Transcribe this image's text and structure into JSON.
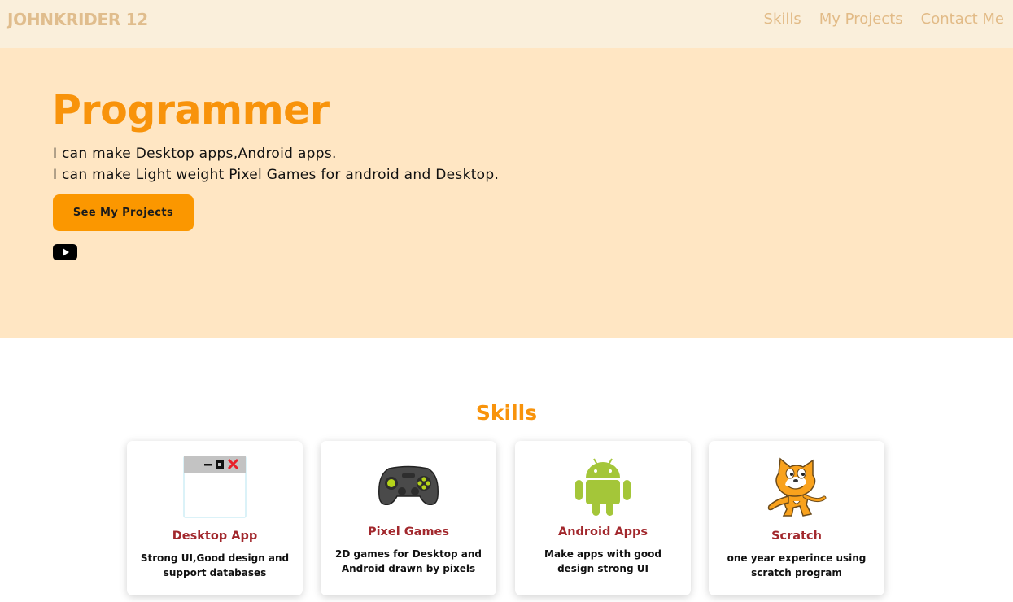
{
  "nav": {
    "brand": "JOHNKRIDER 12",
    "links": [
      "Skills",
      "My Projects",
      "Contact Me"
    ]
  },
  "hero": {
    "title": "Programmer",
    "line1": "I can make Desktop apps,Android apps.",
    "line2": "I can make Light weight Pixel Games for android and Desktop.",
    "cta": "See My Projects",
    "social_icon": "youtube-icon"
  },
  "skills": {
    "heading": "Skills",
    "cards": [
      {
        "icon": "desktop-window-icon",
        "title": "Desktop App",
        "desc": "Strong UI,Good design and support databases"
      },
      {
        "icon": "gamepad-icon",
        "title": "Pixel Games",
        "desc": "2D games for Desktop and Android drawn by pixels"
      },
      {
        "icon": "android-icon",
        "title": "Android Apps",
        "desc": "Make apps with good design strong UI"
      },
      {
        "icon": "scratch-cat-icon",
        "title": "Scratch",
        "desc": "one year experince using scratch program"
      }
    ]
  },
  "colors": {
    "accent": "#f8930b",
    "nav_bg": "#faefdb",
    "hero_bg": "#ffe6c3",
    "card_title": "#a2282d"
  }
}
